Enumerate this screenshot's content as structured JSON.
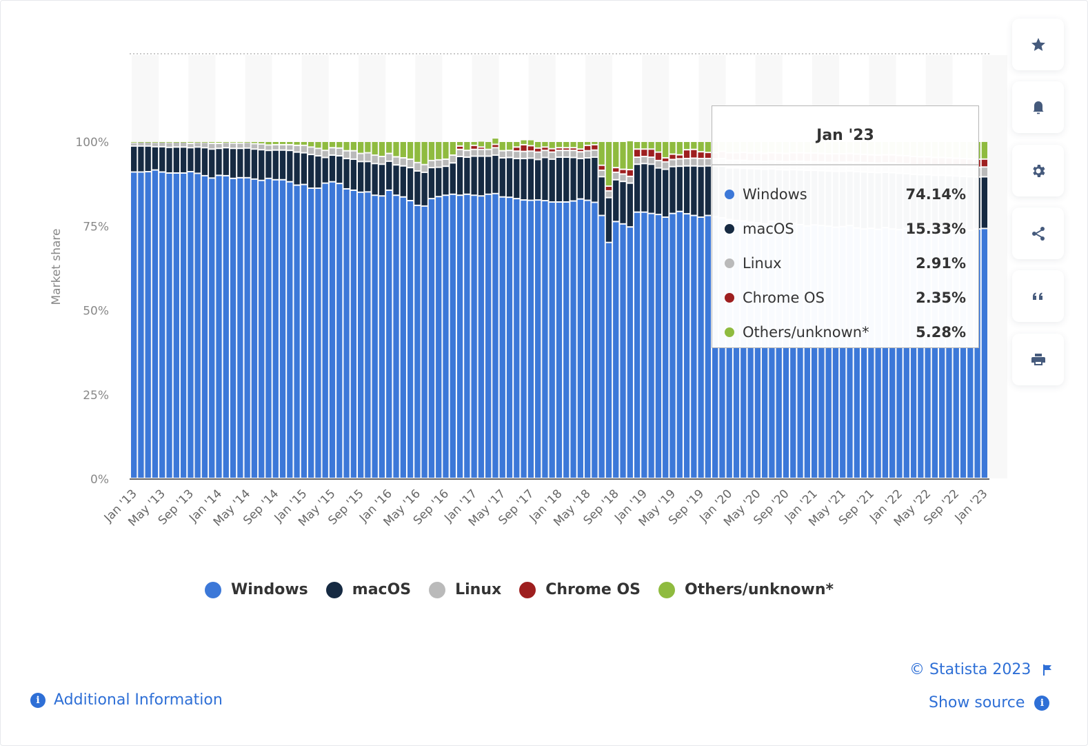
{
  "chart_data": {
    "type": "bar",
    "stacked": true,
    "title": "",
    "xlabel": "",
    "ylabel": "Market share",
    "ylim": [
      0,
      100
    ],
    "y_ticks": [
      "0%",
      "25%",
      "50%",
      "75%",
      "100%"
    ],
    "x_tick_labels": [
      "Jan '13",
      "May '13",
      "Sep '13",
      "Jan '14",
      "May '14",
      "Sep '14",
      "Jan '15",
      "May '15",
      "Sep '15",
      "Jan '16",
      "May '16",
      "Sep '16",
      "Jan '17",
      "May '17",
      "Sep '17",
      "Jan '18",
      "May '18",
      "Sep '18",
      "Jan '19",
      "May '19",
      "Sep '19",
      "Jan '20",
      "May '20",
      "Sep '20",
      "Jan '21",
      "May '21",
      "Sep '21",
      "Jan '22",
      "May '22",
      "Sep '22",
      "Jan '23"
    ],
    "x_start": "Jan 2013",
    "x_end": "Jan 2023",
    "x_interval": "monthly",
    "grid": true,
    "legend_position": "bottom",
    "series": [
      {
        "name": "Windows",
        "color": "#3c78d8",
        "values": [
          90.9,
          90.9,
          91.0,
          91.5,
          90.9,
          90.6,
          90.6,
          90.6,
          91.0,
          90.5,
          89.8,
          89.1,
          89.9,
          89.8,
          89.0,
          89.2,
          89.2,
          88.8,
          88.4,
          89.0,
          88.6,
          88.6,
          88.0,
          87.0,
          87.2,
          86.1,
          86.1,
          87.6,
          88.0,
          87.5,
          85.9,
          85.5,
          84.9,
          85.0,
          84.0,
          83.8,
          85.5,
          84.0,
          83.5,
          82.4,
          81.0,
          80.8,
          83.0,
          83.6,
          84.0,
          84.3,
          84.0,
          84.3,
          84.0,
          83.8,
          84.3,
          84.5,
          83.5,
          83.4,
          83.0,
          82.6,
          82.5,
          82.6,
          82.4,
          82.0,
          82.0,
          82.0,
          82.3,
          82.9,
          82.5,
          81.9,
          78.0,
          70.0,
          76.2,
          75.5,
          74.6,
          79.0,
          79.0,
          78.6,
          78.3,
          77.5,
          78.6,
          79.2,
          78.5,
          78.0,
          77.5,
          78.0,
          77.6,
          77.3,
          76.8,
          76.5,
          76.4,
          76.0,
          75.8,
          75.5,
          76.3,
          75.8,
          75.5,
          75.6,
          75.3,
          74.9,
          75.2,
          75.0,
          74.8,
          74.5,
          74.7,
          75.0,
          74.3,
          74.0,
          74.2,
          73.9,
          74.4,
          74.0,
          73.8,
          74.2,
          73.7,
          73.5,
          74.0,
          73.9,
          74.3,
          74.0,
          73.8,
          74.1,
          73.6,
          74.0,
          74.14
        ]
      },
      {
        "name": "macOS",
        "color": "#162a42",
        "values": [
          7.7,
          7.7,
          7.6,
          6.9,
          7.5,
          7.6,
          7.7,
          7.7,
          7.1,
          7.8,
          8.3,
          8.6,
          8.0,
          8.3,
          8.9,
          8.7,
          8.8,
          8.9,
          9.1,
          8.3,
          8.8,
          8.8,
          9.3,
          9.8,
          9.4,
          10.0,
          9.6,
          7.6,
          7.9,
          8.2,
          9.0,
          9.2,
          9.1,
          9.0,
          9.4,
          9.4,
          8.6,
          9.0,
          9.2,
          9.8,
          10.2,
          10.0,
          9.2,
          8.7,
          8.6,
          9.3,
          11.5,
          11.0,
          11.6,
          11.8,
          11.3,
          11.4,
          11.6,
          11.8,
          11.9,
          12.3,
          12.5,
          12.0,
          12.8,
          12.7,
          13.3,
          13.3,
          12.9,
          12.0,
          12.6,
          13.4,
          11.5,
          13.3,
          12.4,
          12.6,
          13.0,
          14.2,
          14.4,
          14.6,
          13.8,
          14.2,
          13.9,
          13.4,
          14.2,
          14.7,
          15.1,
          14.7,
          15.0,
          15.3,
          15.3,
          15.6,
          15.6,
          15.9,
          16.0,
          16.2,
          15.5,
          15.8,
          16.0,
          16.0,
          16.2,
          16.5,
          16.2,
          16.3,
          16.4,
          16.6,
          16.4,
          16.2,
          16.7,
          16.9,
          16.6,
          16.8,
          16.4,
          16.7,
          16.7,
          16.2,
          16.5,
          16.6,
          16.1,
          16.0,
          15.6,
          15.8,
          15.9,
          15.5,
          15.9,
          15.4,
          15.33
        ]
      },
      {
        "name": "Linux",
        "color": "#bababa",
        "values": [
          1.0,
          1.2,
          1.2,
          1.3,
          1.4,
          1.5,
          1.5,
          1.5,
          1.3,
          1.4,
          1.6,
          1.7,
          1.5,
          1.6,
          1.6,
          1.6,
          1.7,
          1.6,
          1.7,
          1.6,
          1.6,
          1.6,
          1.7,
          2.0,
          2.2,
          2.2,
          2.2,
          2.1,
          2.2,
          2.3,
          2.3,
          2.5,
          2.4,
          2.6,
          2.5,
          2.3,
          2.3,
          2.4,
          2.4,
          2.5,
          2.5,
          2.3,
          2.1,
          2.2,
          2.1,
          2.3,
          2.1,
          2.0,
          2.0,
          2.0,
          2.0,
          2.2,
          2.1,
          2.1,
          2.2,
          2.1,
          2.1,
          2.2,
          2.1,
          2.1,
          2.0,
          2.0,
          2.1,
          2.0,
          2.1,
          2.1,
          1.9,
          2.0,
          2.2,
          2.2,
          2.0,
          2.1,
          2.1,
          2.1,
          2.2,
          2.2,
          2.1,
          2.2,
          2.2,
          2.3,
          2.3,
          2.2,
          2.2,
          2.3,
          2.3,
          2.3,
          2.4,
          2.3,
          2.4,
          2.4,
          2.4,
          2.5,
          2.5,
          2.5,
          2.6,
          2.6,
          2.6,
          2.6,
          2.6,
          2.7,
          2.7,
          2.7,
          2.8,
          2.8,
          2.8,
          2.8,
          2.8,
          2.9,
          2.9,
          2.9,
          2.9,
          2.9,
          2.9,
          2.9,
          2.9,
          2.9,
          2.9,
          2.9,
          2.9,
          2.9,
          2.91
        ]
      },
      {
        "name": "Chrome OS",
        "color": "#9e1f1f",
        "values": [
          0,
          0,
          0,
          0,
          0,
          0,
          0,
          0,
          0,
          0,
          0,
          0,
          0,
          0,
          0,
          0,
          0,
          0,
          0,
          0,
          0,
          0,
          0,
          0,
          0,
          0,
          0,
          0,
          0,
          0,
          0,
          0,
          0,
          0,
          0,
          0,
          0,
          0,
          0,
          0,
          0,
          0,
          0,
          0,
          0,
          0,
          1.0,
          0,
          1.2,
          0.7,
          0,
          1.0,
          0,
          0,
          1.2,
          2.0,
          1.6,
          1.2,
          1.0,
          1.0,
          0.8,
          0.8,
          0.8,
          0.8,
          1.6,
          1.6,
          1.5,
          1.4,
          1.4,
          1.4,
          2.0,
          2.4,
          2.2,
          2.4,
          2.5,
          1.2,
          1.6,
          1.2,
          2.6,
          2.6,
          2.0,
          1.8,
          1.8,
          2.1,
          2.2,
          2.2,
          2.3,
          2.3,
          2.3,
          2.3,
          2.4,
          2.4,
          2.4,
          2.5,
          2.5,
          2.5,
          2.5,
          2.5,
          2.5,
          2.5,
          2.5,
          2.5,
          2.4,
          2.4,
          2.4,
          2.4,
          2.4,
          2.4,
          2.4,
          2.4,
          2.4,
          2.4,
          2.4,
          2.4,
          2.4,
          2.4,
          2.4,
          2.4,
          2.4,
          2.4,
          2.35
        ]
      },
      {
        "name": "Others/unknown*",
        "color": "#8fbb3f",
        "values": [
          0.4,
          0.2,
          0.2,
          0.3,
          0.2,
          0.3,
          0.2,
          0.2,
          0.6,
          0.3,
          0.3,
          0.6,
          0.6,
          0.3,
          0.5,
          0.5,
          0.3,
          0.7,
          0.8,
          1.1,
          1.0,
          1.0,
          1.0,
          1.2,
          1.2,
          1.7,
          2.1,
          2.7,
          1.9,
          2.0,
          2.8,
          2.8,
          3.6,
          3.4,
          4.1,
          4.5,
          3.6,
          4.6,
          4.9,
          5.3,
          6.3,
          6.9,
          5.7,
          5.5,
          5.3,
          4.1,
          1.4,
          2.7,
          1.2,
          1.8,
          2.4,
          1.9,
          2.8,
          2.7,
          1.7,
          1.5,
          1.8,
          2.0,
          1.7,
          2.2,
          1.9,
          1.9,
          1.9,
          2.3,
          1.2,
          1.0,
          7.1,
          13.3,
          7.8,
          8.3,
          8.6,
          2.3,
          2.3,
          2.3,
          3.2,
          4.9,
          3.8,
          4.0,
          2.5,
          2.4,
          3.1,
          3.3,
          3.4,
          3.0,
          3.4,
          3.4,
          3.3,
          3.5,
          3.5,
          3.6,
          3.4,
          3.5,
          3.6,
          3.4,
          3.4,
          3.5,
          3.5,
          3.6,
          3.7,
          3.7,
          3.7,
          3.6,
          3.8,
          3.9,
          4.0,
          4.1,
          4.0,
          4.0,
          4.2,
          4.3,
          4.5,
          4.6,
          4.6,
          4.8,
          4.8,
          4.9,
          5.0,
          5.1,
          5.2,
          5.3,
          5.28
        ]
      }
    ]
  },
  "tooltip": {
    "title": "Jan '23",
    "rows": [
      {
        "label": "Windows",
        "value": "74.14%",
        "color": "#3c78d8"
      },
      {
        "label": "macOS",
        "value": "15.33%",
        "color": "#162a42"
      },
      {
        "label": "Linux",
        "value": "2.91%",
        "color": "#bababa"
      },
      {
        "label": "Chrome OS",
        "value": "2.35%",
        "color": "#9e1f1f"
      },
      {
        "label": "Others/unknown*",
        "value": "5.28%",
        "color": "#8fbb3f"
      }
    ]
  },
  "legend": [
    {
      "label": "Windows",
      "color": "#3c78d8"
    },
    {
      "label": "macOS",
      "color": "#162a42"
    },
    {
      "label": "Linux",
      "color": "#bababa"
    },
    {
      "label": "Chrome OS",
      "color": "#9e1f1f"
    },
    {
      "label": "Others/unknown*",
      "color": "#8fbb3f"
    }
  ],
  "sidebar_buttons": [
    {
      "name": "favorite",
      "icon": "star-icon"
    },
    {
      "name": "notification",
      "icon": "bell-icon"
    },
    {
      "name": "settings",
      "icon": "gear-icon"
    },
    {
      "name": "share",
      "icon": "share-icon"
    },
    {
      "name": "cite",
      "icon": "quote-icon"
    },
    {
      "name": "print",
      "icon": "print-icon"
    }
  ],
  "footer": {
    "additional_info": "Additional Information",
    "copyright": "© Statista 2023",
    "show_source": "Show source",
    "info_glyph": "i"
  },
  "colors": {
    "accent_link": "#2e6fd6",
    "icon": "#455a7c"
  }
}
